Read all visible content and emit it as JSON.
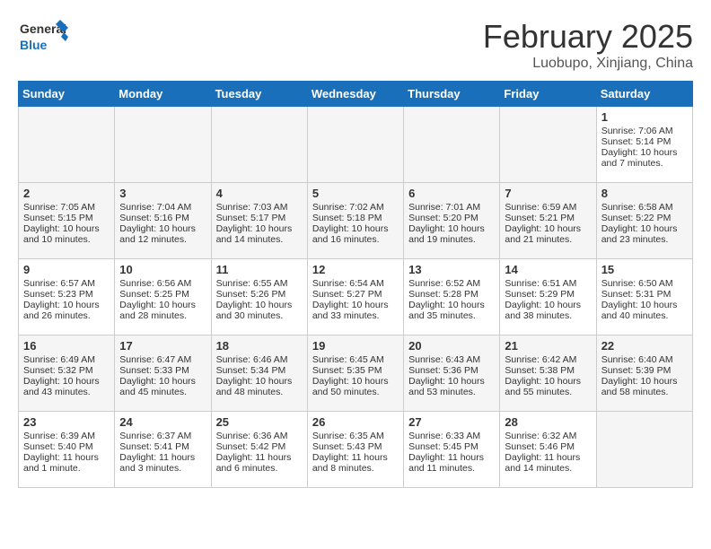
{
  "logo": {
    "line1": "General",
    "line2": "Blue"
  },
  "title": "February 2025",
  "location": "Luobupo, Xinjiang, China",
  "days_of_week": [
    "Sunday",
    "Monday",
    "Tuesday",
    "Wednesday",
    "Thursday",
    "Friday",
    "Saturday"
  ],
  "weeks": [
    [
      {
        "day": "",
        "empty": true
      },
      {
        "day": "",
        "empty": true
      },
      {
        "day": "",
        "empty": true
      },
      {
        "day": "",
        "empty": true
      },
      {
        "day": "",
        "empty": true
      },
      {
        "day": "",
        "empty": true
      },
      {
        "day": "1",
        "sunrise": "7:06 AM",
        "sunset": "5:14 PM",
        "daylight": "10 hours and 7 minutes."
      }
    ],
    [
      {
        "day": "2",
        "sunrise": "7:05 AM",
        "sunset": "5:15 PM",
        "daylight": "10 hours and 10 minutes."
      },
      {
        "day": "3",
        "sunrise": "7:04 AM",
        "sunset": "5:16 PM",
        "daylight": "10 hours and 12 minutes."
      },
      {
        "day": "4",
        "sunrise": "7:03 AM",
        "sunset": "5:17 PM",
        "daylight": "10 hours and 14 minutes."
      },
      {
        "day": "5",
        "sunrise": "7:02 AM",
        "sunset": "5:18 PM",
        "daylight": "10 hours and 16 minutes."
      },
      {
        "day": "6",
        "sunrise": "7:01 AM",
        "sunset": "5:20 PM",
        "daylight": "10 hours and 19 minutes."
      },
      {
        "day": "7",
        "sunrise": "6:59 AM",
        "sunset": "5:21 PM",
        "daylight": "10 hours and 21 minutes."
      },
      {
        "day": "8",
        "sunrise": "6:58 AM",
        "sunset": "5:22 PM",
        "daylight": "10 hours and 23 minutes."
      }
    ],
    [
      {
        "day": "9",
        "sunrise": "6:57 AM",
        "sunset": "5:23 PM",
        "daylight": "10 hours and 26 minutes."
      },
      {
        "day": "10",
        "sunrise": "6:56 AM",
        "sunset": "5:25 PM",
        "daylight": "10 hours and 28 minutes."
      },
      {
        "day": "11",
        "sunrise": "6:55 AM",
        "sunset": "5:26 PM",
        "daylight": "10 hours and 30 minutes."
      },
      {
        "day": "12",
        "sunrise": "6:54 AM",
        "sunset": "5:27 PM",
        "daylight": "10 hours and 33 minutes."
      },
      {
        "day": "13",
        "sunrise": "6:52 AM",
        "sunset": "5:28 PM",
        "daylight": "10 hours and 35 minutes."
      },
      {
        "day": "14",
        "sunrise": "6:51 AM",
        "sunset": "5:29 PM",
        "daylight": "10 hours and 38 minutes."
      },
      {
        "day": "15",
        "sunrise": "6:50 AM",
        "sunset": "5:31 PM",
        "daylight": "10 hours and 40 minutes."
      }
    ],
    [
      {
        "day": "16",
        "sunrise": "6:49 AM",
        "sunset": "5:32 PM",
        "daylight": "10 hours and 43 minutes."
      },
      {
        "day": "17",
        "sunrise": "6:47 AM",
        "sunset": "5:33 PM",
        "daylight": "10 hours and 45 minutes."
      },
      {
        "day": "18",
        "sunrise": "6:46 AM",
        "sunset": "5:34 PM",
        "daylight": "10 hours and 48 minutes."
      },
      {
        "day": "19",
        "sunrise": "6:45 AM",
        "sunset": "5:35 PM",
        "daylight": "10 hours and 50 minutes."
      },
      {
        "day": "20",
        "sunrise": "6:43 AM",
        "sunset": "5:36 PM",
        "daylight": "10 hours and 53 minutes."
      },
      {
        "day": "21",
        "sunrise": "6:42 AM",
        "sunset": "5:38 PM",
        "daylight": "10 hours and 55 minutes."
      },
      {
        "day": "22",
        "sunrise": "6:40 AM",
        "sunset": "5:39 PM",
        "daylight": "10 hours and 58 minutes."
      }
    ],
    [
      {
        "day": "23",
        "sunrise": "6:39 AM",
        "sunset": "5:40 PM",
        "daylight": "11 hours and 1 minute."
      },
      {
        "day": "24",
        "sunrise": "6:37 AM",
        "sunset": "5:41 PM",
        "daylight": "11 hours and 3 minutes."
      },
      {
        "day": "25",
        "sunrise": "6:36 AM",
        "sunset": "5:42 PM",
        "daylight": "11 hours and 6 minutes."
      },
      {
        "day": "26",
        "sunrise": "6:35 AM",
        "sunset": "5:43 PM",
        "daylight": "11 hours and 8 minutes."
      },
      {
        "day": "27",
        "sunrise": "6:33 AM",
        "sunset": "5:45 PM",
        "daylight": "11 hours and 11 minutes."
      },
      {
        "day": "28",
        "sunrise": "6:32 AM",
        "sunset": "5:46 PM",
        "daylight": "11 hours and 14 minutes."
      },
      {
        "day": "",
        "empty": true
      }
    ]
  ]
}
